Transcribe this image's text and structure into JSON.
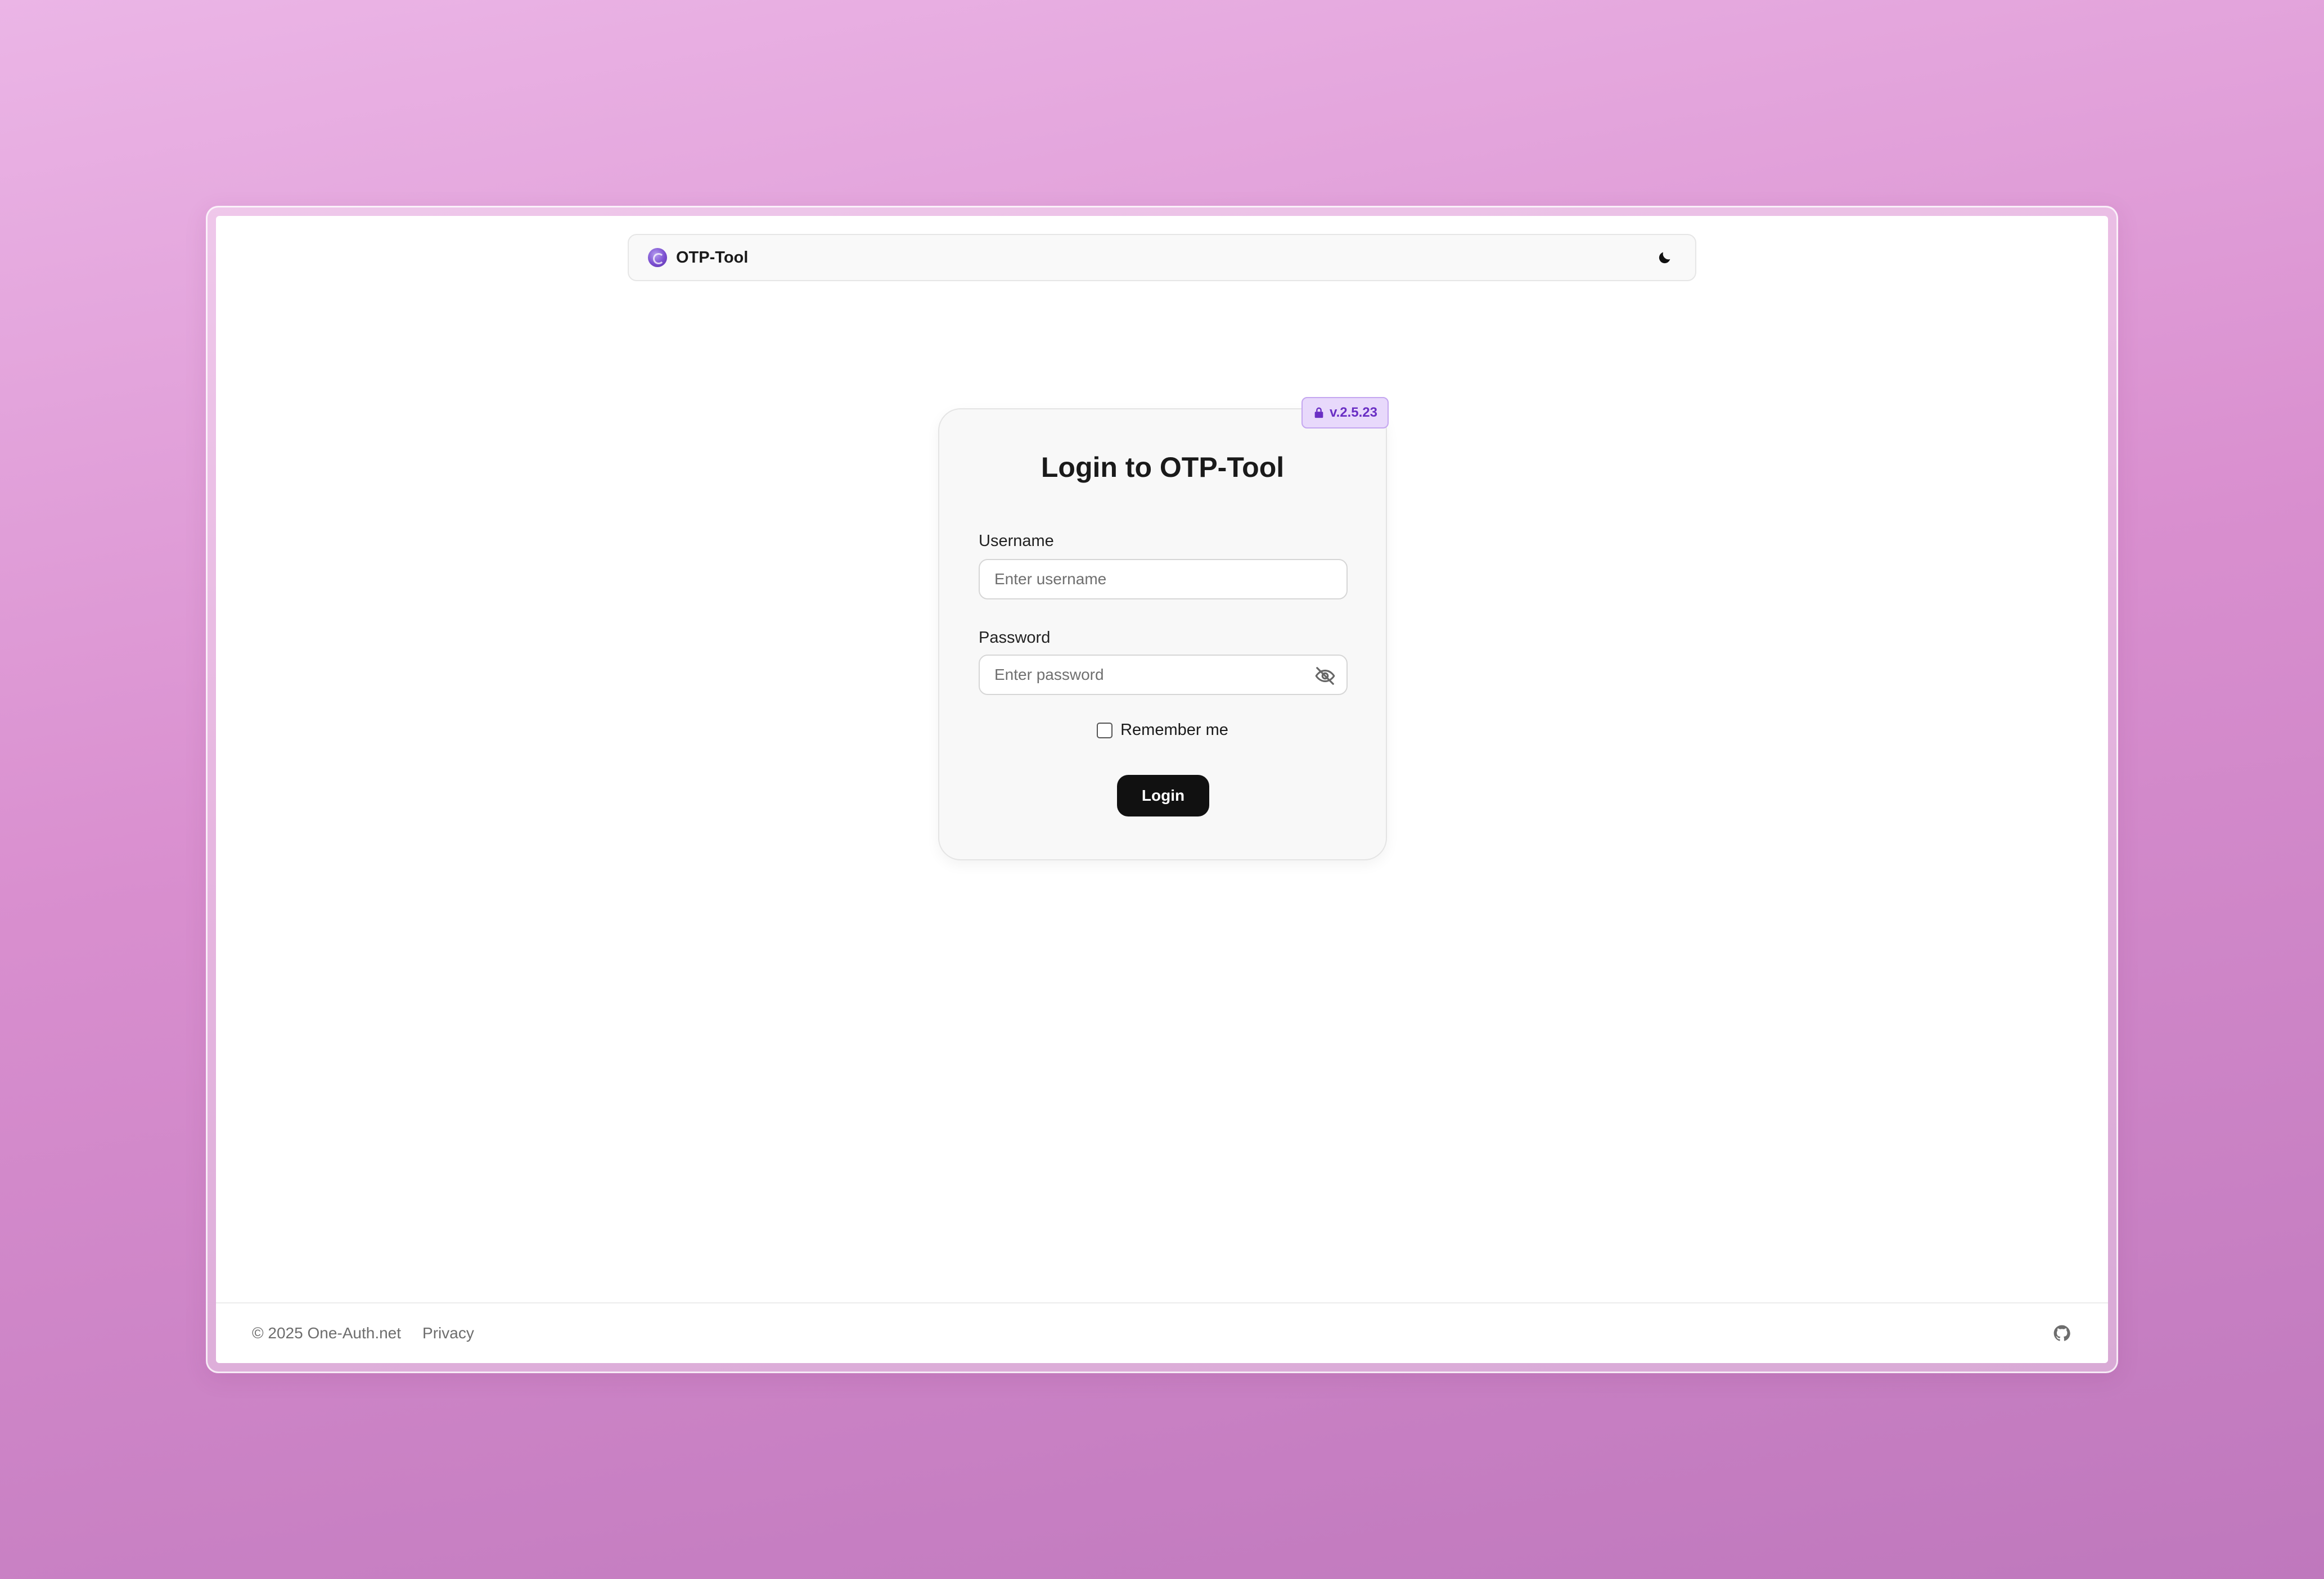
{
  "header": {
    "brand_name": "OTP-Tool",
    "logo_icon": "otp-tool-logo-icon",
    "theme_toggle_icon": "moon-icon"
  },
  "badge": {
    "icon": "lock-icon",
    "version": "v.2.5.23",
    "accent": "#6a2fc4"
  },
  "login": {
    "title": "Login to OTP-Tool",
    "username_label": "Username",
    "username_placeholder": "Enter username",
    "password_label": "Password",
    "password_placeholder": "Enter password",
    "password_toggle_icon": "eye-off-icon",
    "remember_label": "Remember me",
    "remember_checked": false,
    "submit_label": "Login"
  },
  "footer": {
    "copyright": "© 2025 One-Auth.net",
    "privacy_label": "Privacy",
    "github_icon": "github-icon"
  }
}
